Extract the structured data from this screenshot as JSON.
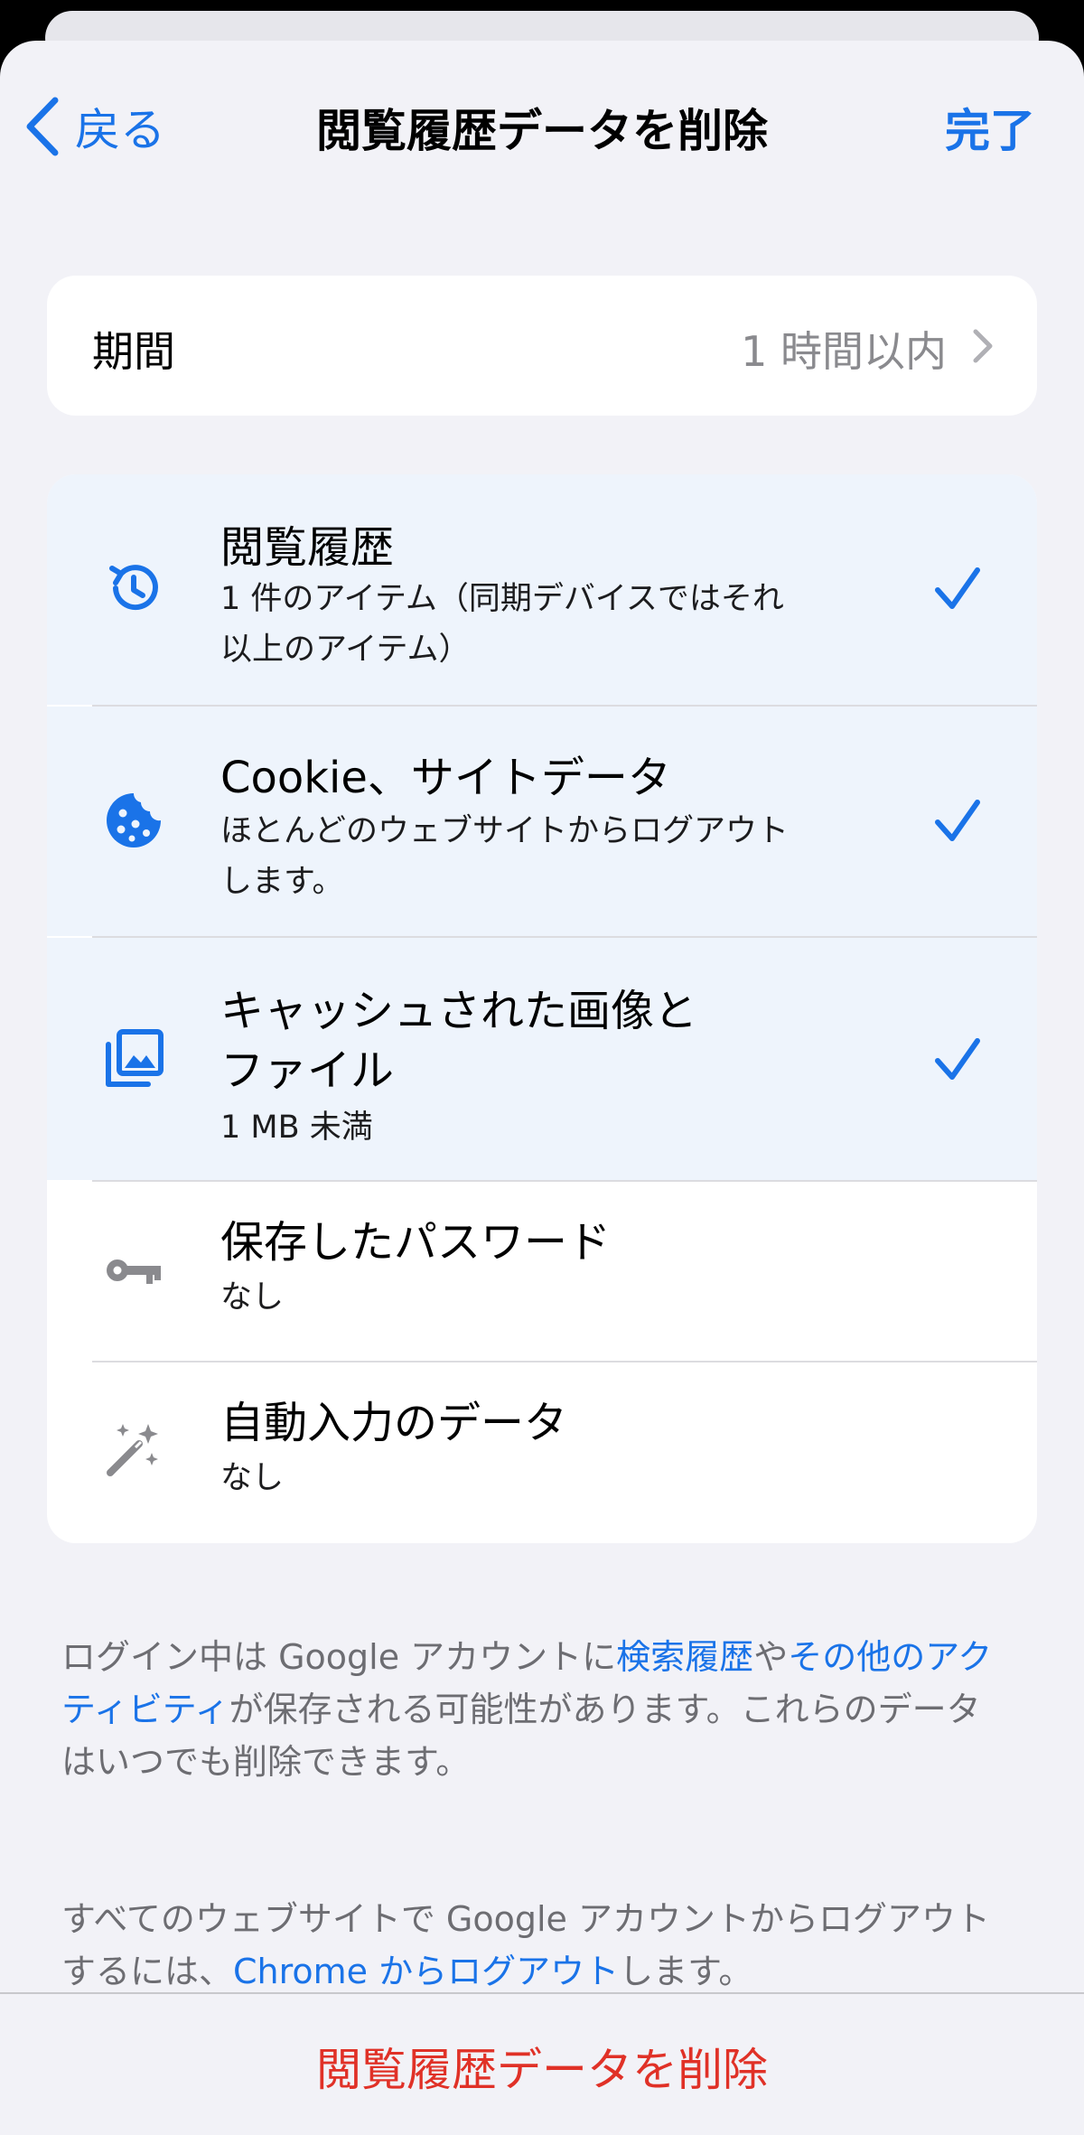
{
  "nav": {
    "back_label": "戻る",
    "title": "閲覧履歴データを削除",
    "done_label": "完了"
  },
  "period": {
    "label": "期間",
    "value": "1 時間以内"
  },
  "items": [
    {
      "title": "閲覧履歴",
      "subtitle_line1": "1 件のアイテム（同期デバイスではそれ",
      "subtitle_line2": "以上のアイテム）",
      "selected": true,
      "icon": "history-icon"
    },
    {
      "title": "Cookie、サイトデータ",
      "subtitle_line1": "ほとんどのウェブサイトからログアウト",
      "subtitle_line2": "します。",
      "selected": true,
      "icon": "cookie-icon"
    },
    {
      "title_line1": "キャッシュされた画像と",
      "title_line2": "ファイル",
      "subtitle": "1 MB 未満",
      "selected": true,
      "icon": "image-stack-icon"
    },
    {
      "title": "保存したパスワード",
      "subtitle": "なし",
      "selected": false,
      "icon": "key-icon"
    },
    {
      "title": "自動入力のデータ",
      "subtitle": "なし",
      "selected": false,
      "icon": "magic-wand-icon"
    }
  ],
  "footer1": {
    "line1_a": "ログイン中は Google アカウントに",
    "link_search_history": "検索履歴",
    "line1_b": "や",
    "link_other_activity_a": "その他のアク",
    "link_other_activity_b": "ティビティ",
    "line2_b": "が保存される可能性があります。これらのデータ",
    "line3": "はいつでも削除できます。"
  },
  "footer2": {
    "line1": "すべてのウェブサイトで Google アカウントからログアウト",
    "line2_a": "するには、",
    "link_signout": "Chrome からログアウト",
    "line2_b": "します。"
  },
  "bottom": {
    "delete_label": "閲覧履歴データを削除"
  },
  "colors": {
    "accent": "#1a73e8",
    "destructive": "#e03127",
    "selected_row": "#eef4fc",
    "background": "#f2f2f7"
  }
}
